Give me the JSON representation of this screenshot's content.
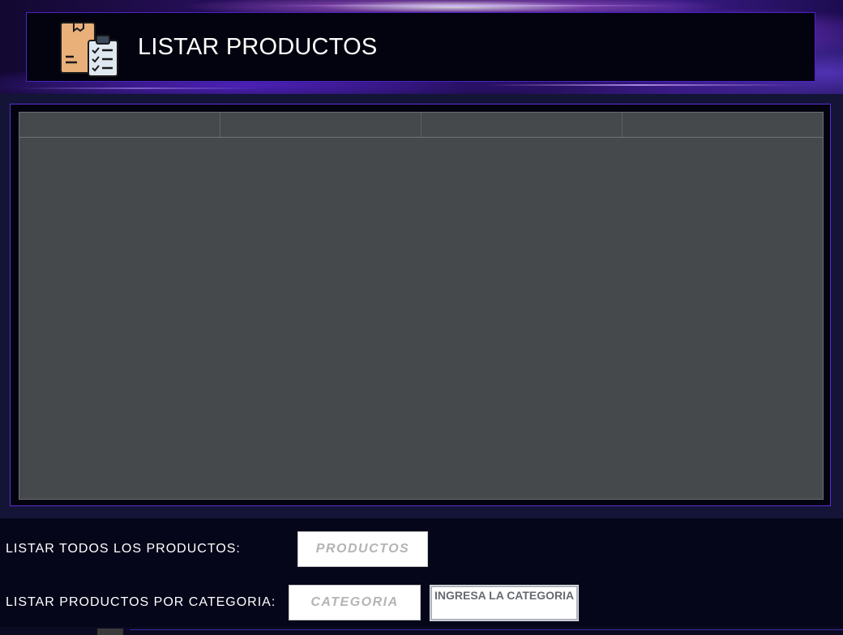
{
  "header": {
    "title": "LISTAR PRODUCTOS",
    "icon": "product-checklist-icon"
  },
  "table": {
    "columns": [
      "",
      "",
      "",
      ""
    ],
    "rows": []
  },
  "actions": {
    "list_all_label": "LISTAR TODOS LOS PRODUCTOS:",
    "list_all_button": "PRODUCTOS",
    "list_by_category_label": "LISTAR PRODUCTOS POR CATEGORIA:",
    "list_by_category_button": "CATEGORIA",
    "category_input_value": "INGRESA LA CATEGORIA"
  },
  "colors": {
    "accent_border": "#5a2ed8",
    "table_bg": "#46494c",
    "panel_bg": "#141436",
    "header_bg": "#03030f"
  }
}
